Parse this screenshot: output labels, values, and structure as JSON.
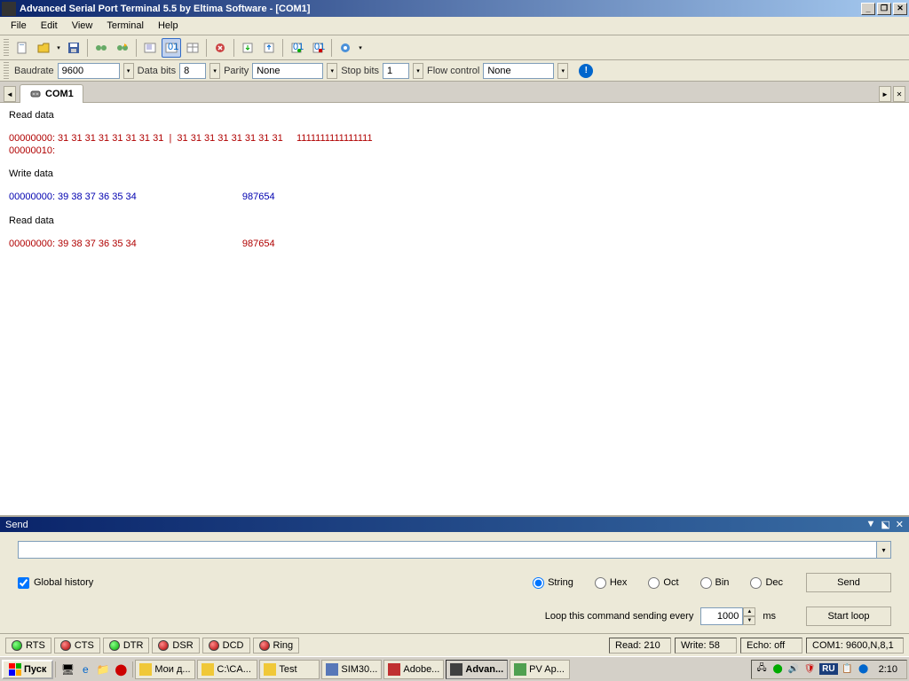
{
  "window": {
    "title": "Advanced Serial Port Terminal 5.5 by Eltima Software - [COM1]"
  },
  "menu": [
    "File",
    "Edit",
    "View",
    "Terminal",
    "Help"
  ],
  "params": {
    "baudrate_label": "Baudrate",
    "baudrate": "9600",
    "databits_label": "Data bits",
    "databits": "8",
    "parity_label": "Parity",
    "parity": "None",
    "stopbits_label": "Stop bits",
    "stopbits": "1",
    "flow_label": "Flow control",
    "flow": "None"
  },
  "tab": {
    "label": "COM1"
  },
  "terminal_lines": [
    {
      "cls": "hdr",
      "text": "Read data"
    },
    {
      "cls": "",
      "text": ""
    },
    {
      "cls": "read",
      "text": "00000000: 31 31 31 31 31 31 31 31  |  31 31 31 31 31 31 31 31     1111111111111111"
    },
    {
      "cls": "read",
      "text": "00000010:"
    },
    {
      "cls": "",
      "text": ""
    },
    {
      "cls": "hdr",
      "text": "Write data"
    },
    {
      "cls": "",
      "text": ""
    },
    {
      "cls": "write",
      "text": "00000000: 39 38 37 36 35 34                                       987654"
    },
    {
      "cls": "",
      "text": ""
    },
    {
      "cls": "hdr",
      "text": "Read data"
    },
    {
      "cls": "",
      "text": ""
    },
    {
      "cls": "read",
      "text": "00000000: 39 38 37 36 35 34                                       987654"
    }
  ],
  "send": {
    "panel_title": "Send",
    "global_history": "Global history",
    "formats": [
      "String",
      "Hex",
      "Oct",
      "Bin",
      "Dec"
    ],
    "send_btn": "Send",
    "loop_label": "Loop this command sending every",
    "loop_value": "1000",
    "loop_unit": "ms",
    "startloop_btn": "Start loop"
  },
  "leds": [
    {
      "name": "RTS",
      "color": "green"
    },
    {
      "name": "CTS",
      "color": "red"
    },
    {
      "name": "DTR",
      "color": "green"
    },
    {
      "name": "DSR",
      "color": "red"
    },
    {
      "name": "DCD",
      "color": "red"
    },
    {
      "name": "Ring",
      "color": "red"
    }
  ],
  "status": {
    "read": "Read:  210",
    "write": "Write:  58",
    "echo": "Echo: off",
    "port": "COM1: 9600,N,8,1"
  },
  "taskbar": {
    "start": "Пуск",
    "tasks": [
      {
        "label": "Мои д...",
        "color": "#f0c838"
      },
      {
        "label": "C:\\CA...",
        "color": "#f0c838"
      },
      {
        "label": "Test",
        "color": "#f0c838"
      },
      {
        "label": "SIM30...",
        "color": "#5878b8"
      },
      {
        "label": "Adobe...",
        "color": "#c03030"
      },
      {
        "label": "Advan...",
        "color": "#404040",
        "active": true
      },
      {
        "label": "PV Ap...",
        "color": "#50a050"
      }
    ],
    "lang": "RU",
    "clock": "2:10"
  }
}
